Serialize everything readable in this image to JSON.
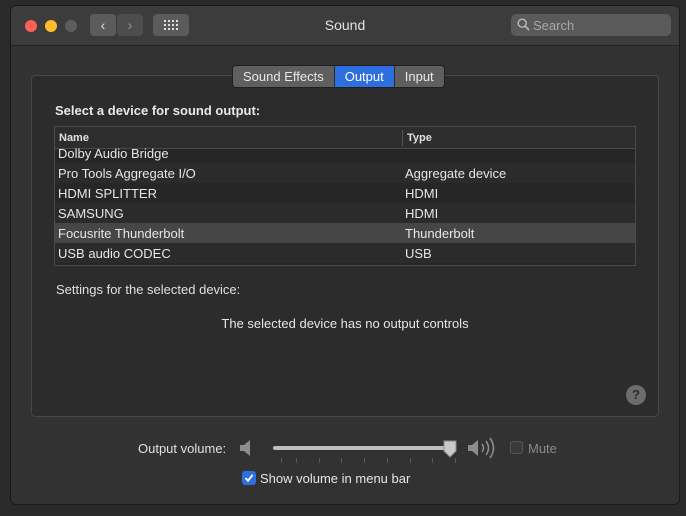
{
  "window": {
    "title": "Sound"
  },
  "search": {
    "placeholder": "Search"
  },
  "nav": {
    "back_icon": "chevron-left-icon",
    "forward_icon": "chevron-right-icon",
    "grid_icon": "grid-icon"
  },
  "tabs": [
    {
      "label": "Sound Effects",
      "active": false
    },
    {
      "label": "Output",
      "active": true
    },
    {
      "label": "Input",
      "active": false
    }
  ],
  "output": {
    "select_label": "Select a device for sound output:",
    "columns": {
      "name": "Name",
      "type": "Type"
    },
    "devices": [
      {
        "name": "Dolby Audio Bridge",
        "type": ""
      },
      {
        "name": "Pro Tools Aggregate I/O",
        "type": "Aggregate device"
      },
      {
        "name": "HDMI SPLITTER",
        "type": "HDMI"
      },
      {
        "name": "SAMSUNG",
        "type": "HDMI"
      },
      {
        "name": "Focusrite Thunderbolt",
        "type": "Thunderbolt"
      },
      {
        "name": "USB audio CODEC",
        "type": "USB"
      }
    ],
    "selected_index": 4,
    "settings_label": "Settings for the selected device:",
    "no_controls": "The selected device has no output controls",
    "help": "?"
  },
  "volume": {
    "label": "Output volume:",
    "level": 0.97,
    "mute_label": "Mute",
    "muted": false,
    "show_in_menu_bar_label": "Show volume in menu bar",
    "show_in_menu_bar": true
  },
  "colors": {
    "accent": "#2e6fe0",
    "close": "#fe5f57",
    "minimize": "#febc2e"
  }
}
